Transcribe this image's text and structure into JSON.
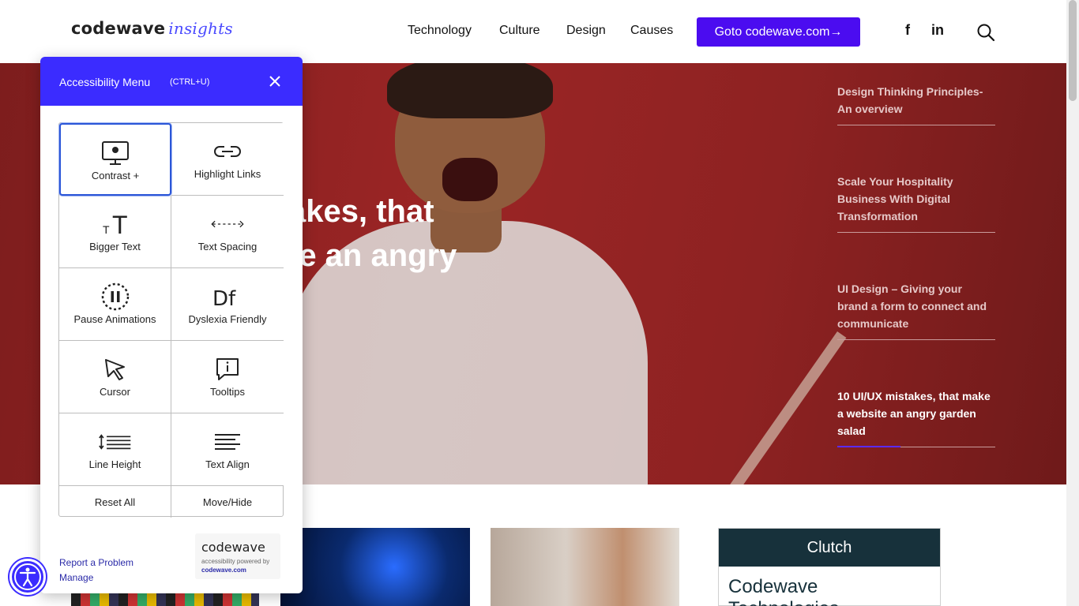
{
  "header": {
    "logo_main": "codewave",
    "logo_accent": "insights",
    "nav": [
      "Technology",
      "Culture",
      "Design",
      "Causes"
    ],
    "cta_label": "Goto codewave.com→",
    "social": {
      "facebook": "f",
      "linkedin": "in"
    }
  },
  "hero": {
    "title_line1": "akes, that",
    "title_line2": "te an angry",
    "side_posts": [
      "Design Thinking Principles- An overview",
      "Scale Your Hospitality Business With Digital Transformation",
      "UI Design – Giving your brand a form to connect and communicate",
      "10 UI/UX mistakes, that make a website an angry garden salad"
    ],
    "active_post_index": 3
  },
  "accessibility": {
    "title": "Accessibility Menu",
    "shortcut": "(CTRL+U)",
    "tiles": [
      {
        "label": "Contrast +",
        "icon": "monitor-icon"
      },
      {
        "label": "Highlight Links",
        "icon": "link-icon"
      },
      {
        "label": "Bigger Text",
        "icon": "text-size-icon"
      },
      {
        "label": "Text Spacing",
        "icon": "text-spacing-icon"
      },
      {
        "label": "Pause Animations",
        "icon": "pause-icon"
      },
      {
        "label": "Dyslexia Friendly",
        "icon": "dyslexia-icon"
      },
      {
        "label": "Cursor",
        "icon": "cursor-icon"
      },
      {
        "label": "Tooltips",
        "icon": "tooltip-icon"
      },
      {
        "label": "Line Height",
        "icon": "line-height-icon"
      },
      {
        "label": "Text Align",
        "icon": "text-align-icon"
      }
    ],
    "icon_glyphs": {
      "bigger_text": "TT",
      "dyslexia": "Df"
    },
    "reset_label": "Reset All",
    "move_label": "Move/Hide",
    "report_label": "Report a Problem",
    "manage_label": "Manage",
    "brand_name": "codewave",
    "brand_sub": "accessibility powered by",
    "brand_url": "codewave.com"
  },
  "clutch": {
    "header": "Clutch",
    "company": "Codewave Technologies"
  },
  "colors": {
    "brand_purple": "#4b0cf0",
    "panel_blue": "#3b2cff",
    "hero_red": "#9b2525"
  }
}
